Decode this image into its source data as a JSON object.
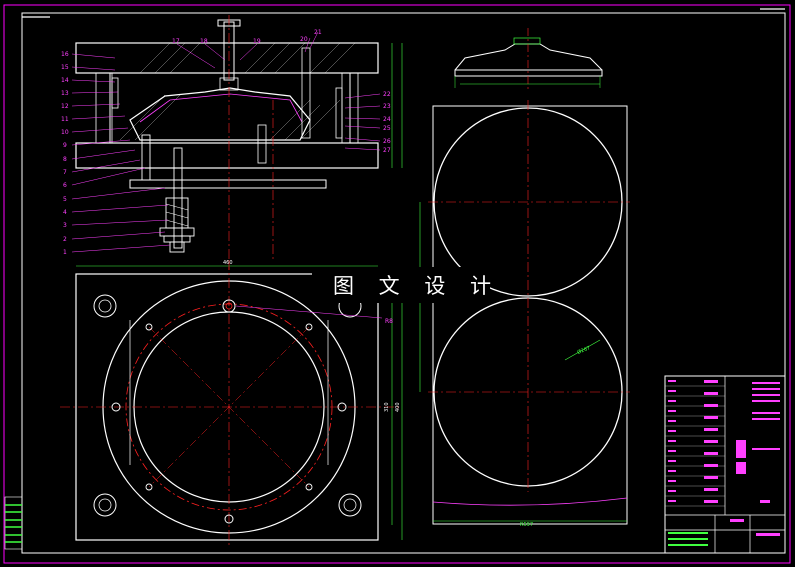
{
  "drawing": {
    "watermark": "图 文 设 计",
    "assembly_callouts": {
      "top": [
        "17",
        "18",
        "19",
        "20",
        "21"
      ],
      "left": [
        "16",
        "15",
        "14",
        "13",
        "12",
        "11",
        "10",
        "9",
        "8",
        "7",
        "6",
        "5",
        "4",
        "3",
        "2",
        "1"
      ],
      "right": [
        "22",
        "23",
        "24",
        "25",
        "26",
        "27"
      ]
    },
    "plan_dimensions": {
      "width": "460",
      "height_a": "310",
      "height_b": "400",
      "hole_tag": "R8"
    },
    "blank_layout": {
      "diameter": "Ø267",
      "strip_width": "R597"
    },
    "colors": {
      "background": "#000000",
      "frame": "#ff00ff",
      "outline": "#ffffff",
      "centerline": "#ff2020",
      "dimension": "#40ff40",
      "callout": "#ff40ff"
    }
  }
}
